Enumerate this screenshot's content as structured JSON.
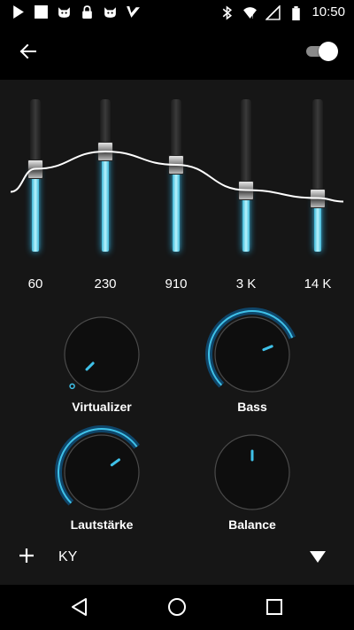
{
  "status_bar": {
    "time": "10:50",
    "left_icons": [
      "play-icon",
      "square-icon",
      "cat-icon",
      "lock-icon",
      "cat-icon",
      "check-icon"
    ],
    "right_icons": [
      "bluetooth-icon",
      "wifi-icon",
      "signal-icon",
      "battery-icon"
    ]
  },
  "app_bar": {
    "back_icon": "arrow-left-icon",
    "toggle_on": true
  },
  "equalizer": {
    "bands": [
      {
        "label": "60",
        "level": 0.55
      },
      {
        "label": "230",
        "level": 0.68
      },
      {
        "label": "910",
        "level": 0.58
      },
      {
        "label": "3 K",
        "level": 0.39
      },
      {
        "label": "14 K",
        "level": 0.33
      }
    ]
  },
  "dials": {
    "virtualizer": {
      "label": "Virtualizer",
      "level": 0.0
    },
    "bass": {
      "label": "Bass",
      "level": 0.75
    },
    "volume": {
      "label": "Lautstärke",
      "level": 0.7
    },
    "balance": {
      "label": "Balance",
      "level": 0.5
    }
  },
  "preset_bar": {
    "add_icon": "plus-icon",
    "preset_name": "KY",
    "dropdown_icon": "triangle-down-icon"
  },
  "nav_bar": {
    "buttons": [
      "back-triangle-icon",
      "home-circle-icon",
      "recents-square-icon"
    ]
  },
  "colors": {
    "accent": "#3fc1e8",
    "panel_bg": "#161616",
    "background": "#000000"
  }
}
